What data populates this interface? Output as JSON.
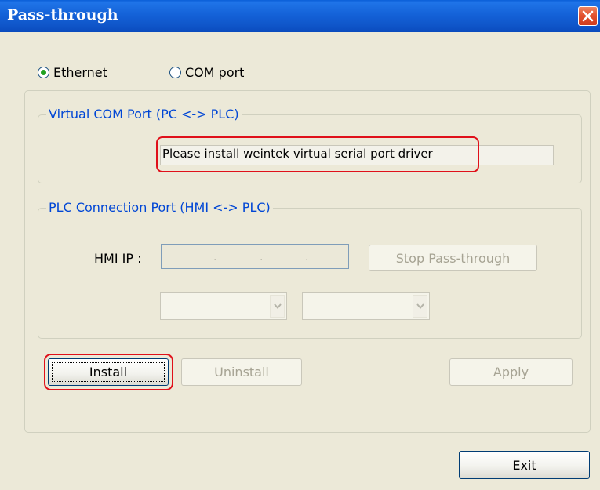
{
  "window": {
    "title": "Pass-through"
  },
  "mode": {
    "options": [
      {
        "label": "Ethernet",
        "selected": true
      },
      {
        "label": "COM port",
        "selected": false
      }
    ]
  },
  "virtual_com": {
    "legend": "Virtual COM Port (PC <-> PLC)",
    "driver_message": "Please install weintek virtual serial port driver"
  },
  "plc_connection": {
    "legend": "PLC Connection Port (HMI <-> PLC)",
    "hmi_ip_label": "HMI IP :",
    "stop_button": "Stop Pass-through",
    "combo1_value": "",
    "combo2_value": ""
  },
  "buttons": {
    "install": "Install",
    "uninstall": "Uninstall",
    "apply": "Apply",
    "exit": "Exit"
  },
  "icons": [
    "close-icon",
    "chevron-down-icon"
  ],
  "colors": {
    "titlebar": "#0a55d0",
    "close_button": "#e3522f",
    "legend_text": "#0046d5",
    "highlight": "#e0101a",
    "dialog_bg": "#ece9d8"
  }
}
